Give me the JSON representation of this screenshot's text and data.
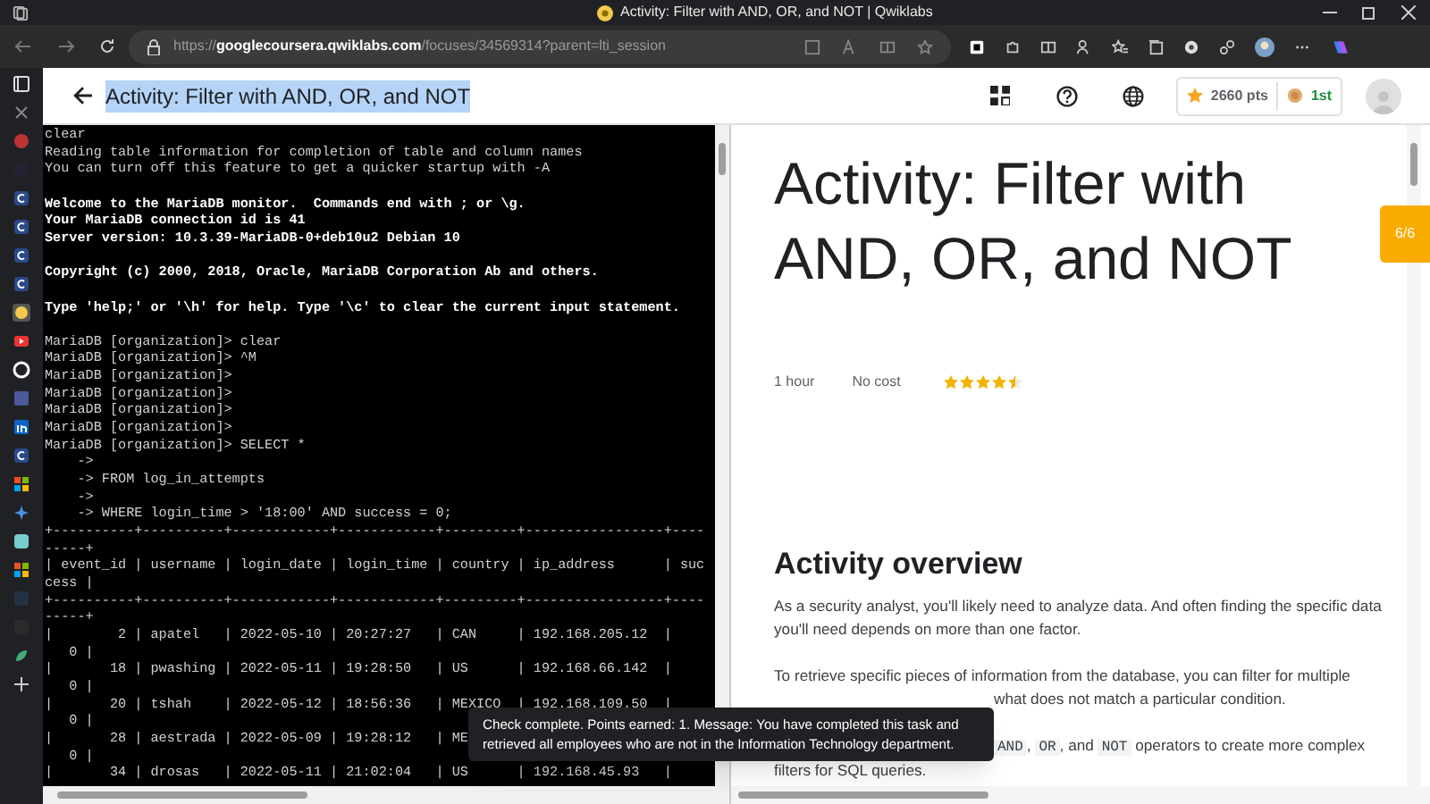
{
  "browser": {
    "tab_title": "Activity: Filter with AND, OR, and NOT | Qwiklabs",
    "url_host": "googlecoursera.qwiklabs.com",
    "url_scheme": "https://",
    "url_path": "/focuses/34569314?parent=lti_session"
  },
  "header": {
    "title": "Activity: Filter with AND, OR, and NOT",
    "title_selected": true,
    "points": "2660 pts",
    "rank": "1st"
  },
  "terminal": {
    "lines": [
      {
        "kind": "normal",
        "text": "clear"
      },
      {
        "kind": "normal",
        "text": "Reading table information for completion of table and column names"
      },
      {
        "kind": "normal",
        "text": "You can turn off this feature to get a quicker startup with -A"
      },
      {
        "kind": "blank"
      },
      {
        "kind": "bold",
        "text": "Welcome to the MariaDB monitor.  Commands end with ; or \\g."
      },
      {
        "kind": "bold",
        "text": "Your MariaDB connection id is 41"
      },
      {
        "kind": "bold",
        "text": "Server version: 10.3.39-MariaDB-0+deb10u2 Debian 10"
      },
      {
        "kind": "blank"
      },
      {
        "kind": "bold",
        "text": "Copyright (c) 2000, 2018, Oracle, MariaDB Corporation Ab and others."
      },
      {
        "kind": "blank"
      },
      {
        "kind": "bold",
        "text": "Type 'help;' or '\\h' for help. Type '\\c' to clear the current input statement."
      },
      {
        "kind": "blank"
      },
      {
        "kind": "normal",
        "text": "MariaDB [organization]> clear"
      },
      {
        "kind": "normal",
        "text": "MariaDB [organization]> ^M"
      },
      {
        "kind": "normal",
        "text": "MariaDB [organization]>"
      },
      {
        "kind": "normal",
        "text": "MariaDB [organization]>"
      },
      {
        "kind": "normal",
        "text": "MariaDB [organization]>"
      },
      {
        "kind": "normal",
        "text": "MariaDB [organization]>"
      },
      {
        "kind": "normal",
        "text": "MariaDB [organization]> SELECT *"
      },
      {
        "kind": "normal",
        "text": "    ->"
      },
      {
        "kind": "normal",
        "text": "    -> FROM log_in_attempts"
      },
      {
        "kind": "normal",
        "text": "    ->"
      },
      {
        "kind": "normal",
        "text": "    -> WHERE login_time > '18:00' AND success = 0;"
      },
      {
        "kind": "normal",
        "text": "+----------+----------+------------+------------+---------+-----------------+----"
      },
      {
        "kind": "normal",
        "text": "-----+"
      },
      {
        "kind": "normal",
        "text": "| event_id | username | login_date | login_time | country | ip_address      | suc"
      },
      {
        "kind": "normal",
        "text": "cess |"
      },
      {
        "kind": "normal",
        "text": "+----------+----------+------------+------------+---------+-----------------+----"
      },
      {
        "kind": "normal",
        "text": "-----+"
      },
      {
        "kind": "normal",
        "text": "|        2 | apatel   | 2022-05-10 | 20:27:27   | CAN     | 192.168.205.12  |"
      },
      {
        "kind": "normal",
        "text": "   0 |"
      },
      {
        "kind": "normal",
        "text": "|       18 | pwashing | 2022-05-11 | 19:28:50   | US      | 192.168.66.142  |"
      },
      {
        "kind": "normal",
        "text": "   0 |"
      },
      {
        "kind": "normal",
        "text": "|       20 | tshah    | 2022-05-12 | 18:56:36   | MEXICO  | 192.168.109.50  |"
      },
      {
        "kind": "normal",
        "text": "   0 |"
      },
      {
        "kind": "normal",
        "text": "|       28 | aestrada | 2022-05-09 | 19:28:12   | ME"
      },
      {
        "kind": "normal",
        "text": "   0 |"
      },
      {
        "kind": "normal",
        "text": "|       34 | drosas   | 2022-05-11 | 21:02:04   | US      | 192.168.45.93   |"
      }
    ]
  },
  "toast": {
    "text": "Check complete. Points earned: 1. Message: You have completed this task and retrieved all employees who are not in the Information Technology department."
  },
  "lab": {
    "title": "Activity: Filter with AND, OR, and NOT",
    "progress": "6/6",
    "duration": "1 hour",
    "cost": "No cost",
    "stars": 4.5,
    "overview_heading": "Activity overview",
    "paragraphs": [
      {
        "lines": [
          {
            "kind": "full",
            "segments": [
              {
                "text": "As a security analyst, you'll likely need to analyze data. And often finding the specific data you'll need depends on more than one factor.",
                "code": false
              }
            ]
          }
        ]
      },
      {
        "lines": [
          {
            "kind": "full",
            "segments": [
              {
                "text": "To retrieve specific pieces of information from the database, you can filter for multiple",
                "code": false
              }
            ]
          },
          {
            "kind": "partial",
            "segments": [
              {
                "text": "what does not match a particular condition.",
                "code": false
              }
            ]
          }
        ]
      },
      {
        "lines": [
          {
            "kind": "partial",
            "segments": [
              {
                "text": "AND",
                "code": true
              },
              {
                "text": ", ",
                "code": false
              },
              {
                "text": "OR",
                "code": true
              },
              {
                "text": ", and ",
                "code": false
              },
              {
                "text": "NOT",
                "code": true
              },
              {
                "text": " operators to create more complex",
                "code": false
              }
            ]
          },
          {
            "kind": "full",
            "segments": [
              {
                "text": "filters for SQL queries.",
                "code": false
              }
            ]
          }
        ]
      }
    ]
  }
}
